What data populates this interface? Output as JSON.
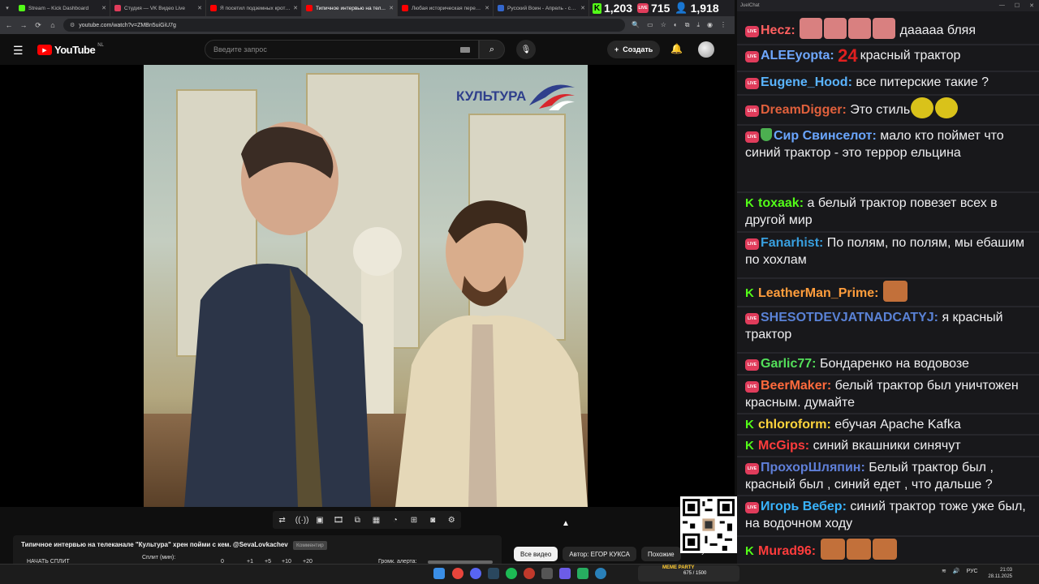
{
  "browser": {
    "tabs": [
      {
        "label": "Stream – Kick Dashboard",
        "color": "#53fc18",
        "active": false
      },
      {
        "label": "Студия — VK Видео Live",
        "color": "#e03c5b",
        "active": false
      },
      {
        "label": "Я посетил подземных кротов...",
        "color": "#ff0000",
        "active": false
      },
      {
        "label": "Типичное интервью на тел...",
        "color": "#ff0000",
        "active": true
      },
      {
        "label": "Любая историческая переда...",
        "color": "#ff0000",
        "active": false
      },
      {
        "label": "Русский Воин - Апрель - смо...",
        "color": "#3366cc",
        "active": false
      }
    ],
    "url": "youtube.com/watch?v=ZMBn5uiGiU7g"
  },
  "stream_stats": {
    "kick_viewers": "1,203",
    "vk_viewers": "715",
    "total_viewers": "1,918"
  },
  "youtube": {
    "logo_text": "YouTube",
    "country": "NL",
    "search_placeholder": "Введите запрос",
    "create_label": "Создать",
    "channel_watermark": "КУЛЬТУРА",
    "video_title": "Типичное интервью на телеканале \"Культура\" хрен пойми с кем. @SevaLovkachev",
    "video_badge": "Комментир",
    "chips": [
      {
        "label": "Все видео",
        "selected": true
      },
      {
        "label": "Автор: ЕГОР КУКСА",
        "selected": false
      },
      {
        "label": "Похожие",
        "selected": false
      }
    ]
  },
  "split_panel": {
    "start_label": "НАЧАТЬ СПЛИТ",
    "split_label": "Сплит (мин):",
    "values": [
      "0",
      "+1",
      "+5",
      "+10",
      "+20"
    ],
    "volume_label": "Громк. алерта:"
  },
  "chat": {
    "window_title": "JuelChat",
    "messages": [
      {
        "platform": "vk",
        "user": "Hecz",
        "color": "#ff6060",
        "text": "дааааа бляя",
        "emotes_before": 4,
        "emote_color": "#d98080"
      },
      {
        "platform": "vk",
        "user": "ALEEyopta",
        "color": "#6fa8ff",
        "text": "красный трактор",
        "prefix_glyph": "24"
      },
      {
        "platform": "vk",
        "user": "Eugene_Hood",
        "color": "#5ab4ff",
        "text": "все питерские такие ?"
      },
      {
        "platform": "vk",
        "user": "DreamDigger",
        "color": "#e0603c",
        "text": "Это стиль",
        "emotes_after": 2,
        "emote_color": "#d9c21a"
      },
      {
        "platform": "vk",
        "user": "Сир Свинселот",
        "color": "#6aa6ff",
        "text": "мало кто поймет что синий трактор - это террор ельцина",
        "shield": true
      },
      {
        "platform": "kick",
        "user": "toxaak",
        "color": "#53fc18",
        "text": "а белый трактор повезет всех в другой мир"
      },
      {
        "platform": "vk",
        "user": "Fanarhist",
        "color": "#39a0e0",
        "text": "По полям, по полям, мы ебашим по хохлам"
      },
      {
        "platform": "kick",
        "user": "LeatherMan_Prime",
        "color": "#ff9d3c",
        "text": ""
      },
      {
        "platform": "vk",
        "user": "SHESOTDEVJATNADCATYJ",
        "color": "#5a82d6",
        "text": "я красный трактор"
      },
      {
        "platform": "vk",
        "user": "Garlic77",
        "color": "#53e05a",
        "text": "Бондаренко на водовозе"
      },
      {
        "platform": "vk",
        "user": "BeerMaker",
        "color": "#ff6a3c",
        "text": "белый трактор был уничтожен красным. думайте"
      },
      {
        "platform": "kick",
        "user": "chloroform",
        "color": "#ffd43c",
        "text": "ебучая Apache Kafka"
      },
      {
        "platform": "kick",
        "user": "McGips",
        "color": "#ff3c3c",
        "text": "синий вкашники синячут"
      },
      {
        "platform": "vk",
        "user": "ПрохорШляпин",
        "color": "#5f7fd8",
        "text": "Белый трактор был , красный был , синий едет , что дальше ?"
      },
      {
        "platform": "vk",
        "user": "Игорь Вебер",
        "color": "#39b4ff",
        "text": "синий трактор тоже уже был, на водочном ходу"
      },
      {
        "platform": "kick",
        "user": "Murad96",
        "color": "#ff3c3c",
        "text": ""
      }
    ]
  },
  "taskbar": {
    "meme_party_label": "MEME PARTY",
    "meme_party_count": "675 / 1500",
    "lang": "РУС",
    "time": "21:03",
    "date": "28.11.2025"
  }
}
